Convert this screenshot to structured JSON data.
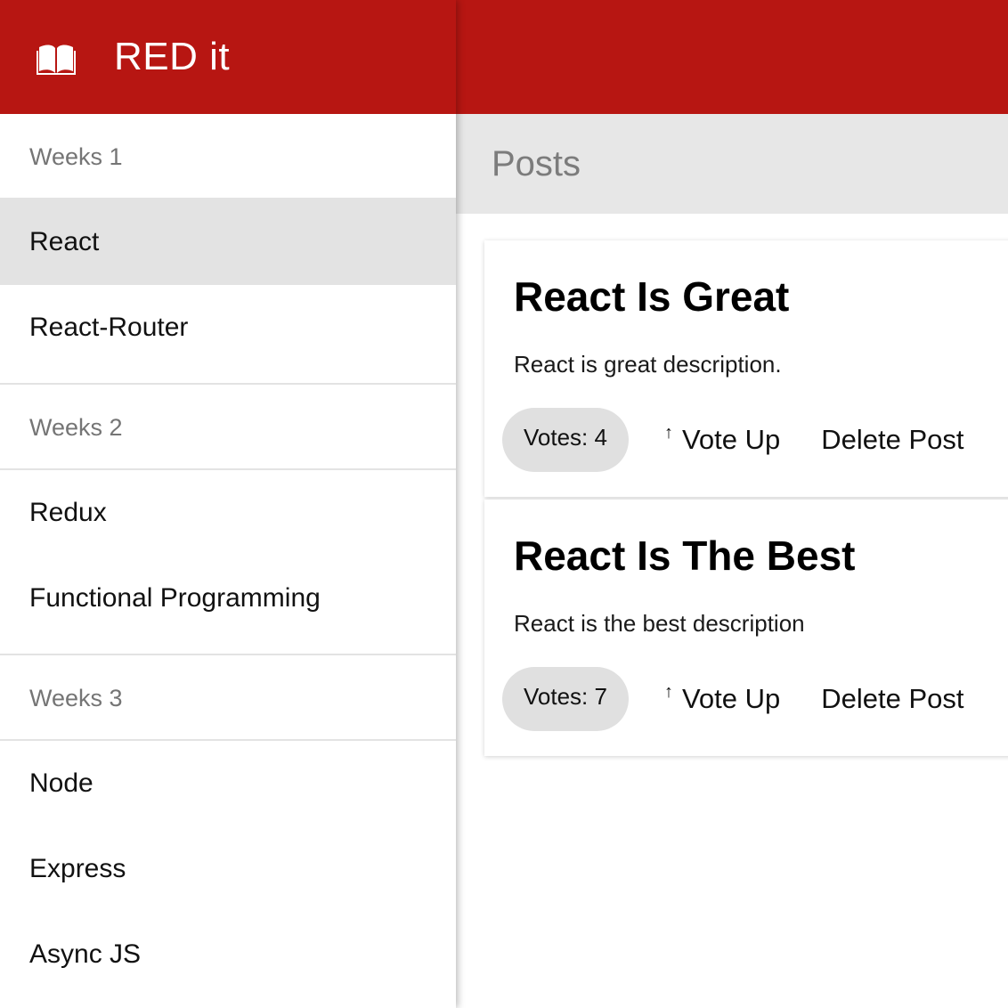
{
  "app": {
    "title": "RED it",
    "logo_icon": "book-icon",
    "brand_color": "#b71612"
  },
  "sidebar": {
    "groups": [
      {
        "label": "Weeks 1",
        "items": [
          {
            "label": "React",
            "active": true
          },
          {
            "label": "React-Router"
          }
        ]
      },
      {
        "label": "Weeks 2",
        "items": [
          {
            "label": "Redux"
          },
          {
            "label": "Functional Programming"
          }
        ]
      },
      {
        "label": "Weeks 3",
        "items": [
          {
            "label": "Node"
          },
          {
            "label": "Express"
          },
          {
            "label": "Async JS"
          }
        ]
      }
    ]
  },
  "main": {
    "title": "Posts",
    "posts": [
      {
        "title": "React Is Great",
        "description": "React is great description.",
        "votes_label": "Votes: 4",
        "vote_up_label": "Vote Up",
        "delete_label": "Delete Post"
      },
      {
        "title": "React Is The Best",
        "description": "React is the best description",
        "votes_label": "Votes: 7",
        "vote_up_label": "Vote Up",
        "delete_label": "Delete Post"
      }
    ],
    "vote_icon": "arrow-up-icon"
  }
}
